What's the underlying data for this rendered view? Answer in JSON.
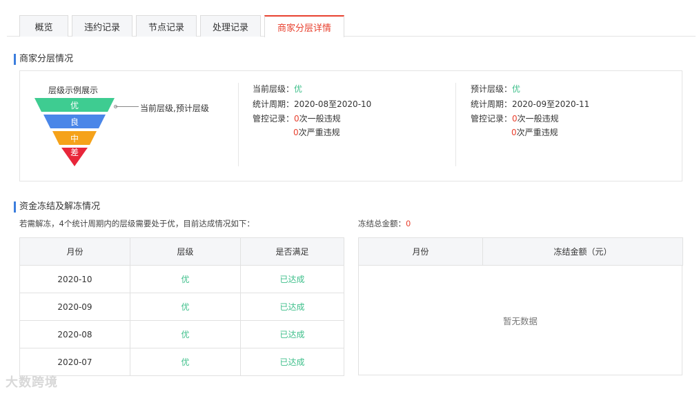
{
  "tabs": [
    {
      "label": "概览"
    },
    {
      "label": "违约记录"
    },
    {
      "label": "节点记录"
    },
    {
      "label": "处理记录"
    },
    {
      "label": "商家分层详情",
      "active": true
    }
  ],
  "layer_section": {
    "title": "商家分层情况",
    "funnel_title": "层级示例展示",
    "funnel_levels": [
      {
        "label": "优",
        "color": "#3ecc91"
      },
      {
        "label": "良",
        "color": "#4a86e8"
      },
      {
        "label": "中",
        "color": "#f5a21a"
      },
      {
        "label": "差",
        "color": "#e8263a"
      }
    ],
    "funnel_pointer_label": "当前层级,预计层级",
    "current": {
      "level_label": "当前层级：",
      "level_value": "优",
      "period_label": "统计周期：",
      "period_value": "2020-08至2020-10",
      "control_label": "管控记录：",
      "general_count": "0",
      "general_text": "次一般违规",
      "serious_count": "0",
      "serious_text": "次严重违规"
    },
    "forecast": {
      "level_label": "预计层级：",
      "level_value": "优",
      "period_label": "统计周期：",
      "period_value": "2020-09至2020-11",
      "control_label": "管控记录：",
      "general_count": "0",
      "general_text": "次一般违规",
      "serious_count": "0",
      "serious_text": "次严重违规"
    }
  },
  "freeze_section": {
    "title": "资金冻结及解冻情况",
    "note": "若需解冻，4个统计周期内的层级需要处于优，目前达成情况如下：",
    "total_label": "冻结总金额：",
    "total_value": "0",
    "left_table": {
      "headers": [
        "月份",
        "层级",
        "是否满足"
      ],
      "rows": [
        [
          "2020-10",
          "优",
          "已达成"
        ],
        [
          "2020-09",
          "优",
          "已达成"
        ],
        [
          "2020-08",
          "优",
          "已达成"
        ],
        [
          "2020-07",
          "优",
          "已达成"
        ]
      ]
    },
    "right_table": {
      "headers": [
        "月份",
        "冻结金额（元）"
      ],
      "empty_text": "暂无数据"
    }
  },
  "watermark": "大数跨境"
}
